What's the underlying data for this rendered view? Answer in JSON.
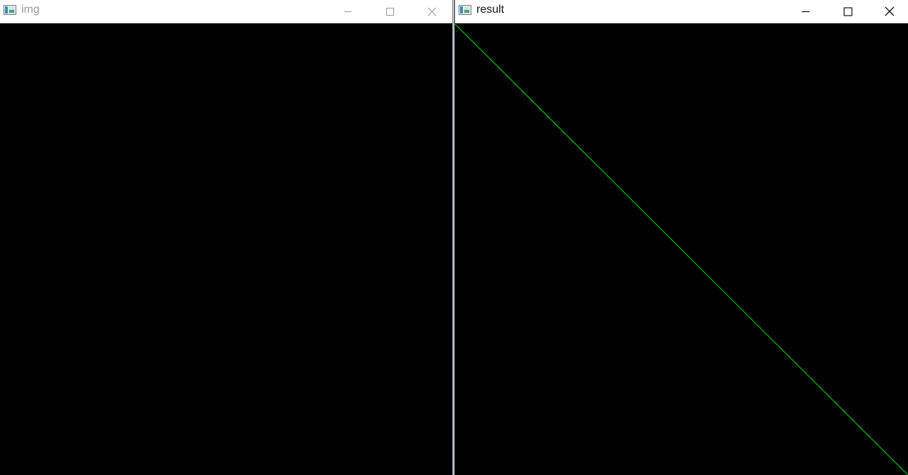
{
  "windows": [
    {
      "id": "img",
      "title": "img",
      "active": false,
      "controls": {
        "minimize": "minimize-icon",
        "maximize": "maximize-icon",
        "close": "close-icon"
      }
    },
    {
      "id": "result",
      "title": "result",
      "active": true,
      "controls": {
        "minimize": "minimize-icon",
        "maximize": "maximize-icon",
        "close": "close-icon"
      }
    }
  ],
  "colors": {
    "canvas_background": "#000000",
    "line": "#00c000",
    "titlebar": "#ffffff",
    "title_active": "#1a1a1a",
    "title_inactive": "#9a9a9a"
  }
}
